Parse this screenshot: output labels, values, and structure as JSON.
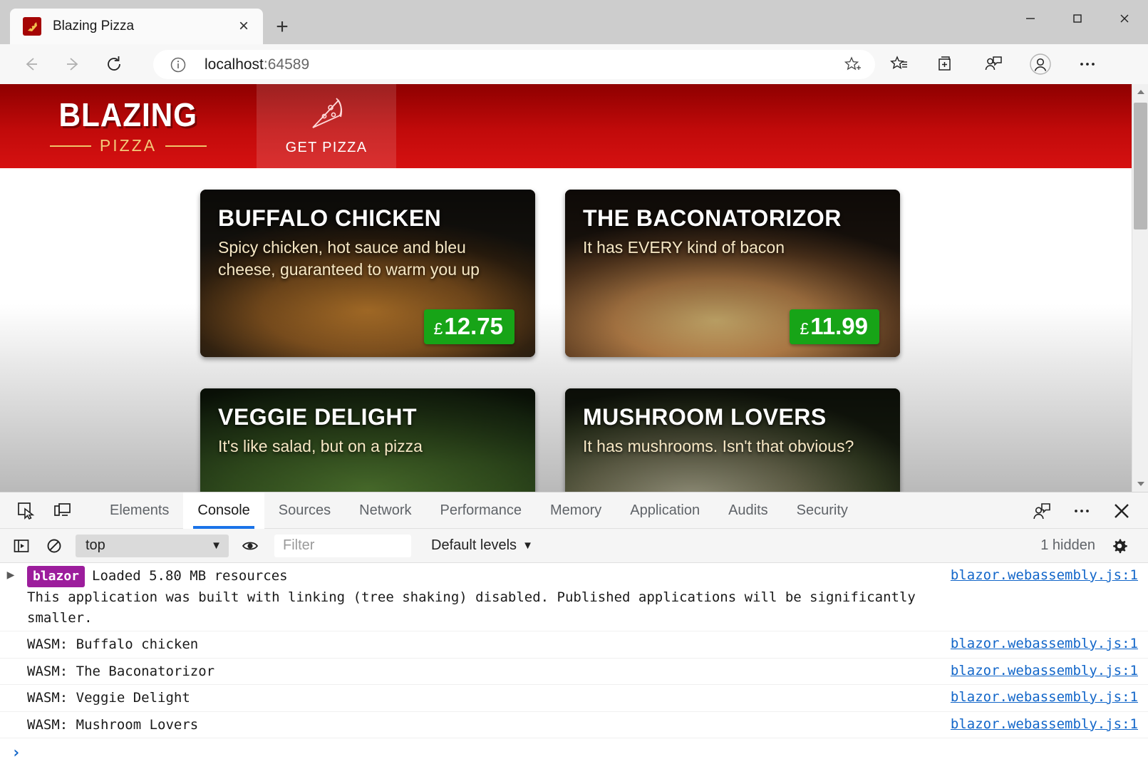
{
  "window": {
    "controls": [
      {
        "name": "minimize-button",
        "glyph": "minimize"
      },
      {
        "name": "maximize-button",
        "glyph": "maximize"
      },
      {
        "name": "close-button",
        "glyph": "close"
      }
    ]
  },
  "browser": {
    "tab": {
      "title": "Blazing Pizza",
      "close_label": "×",
      "favicon": "pizza-slice-icon"
    },
    "new_tab_label": "+",
    "back_icon": "back-arrow-icon",
    "forward_icon": "forward-arrow-icon",
    "reload_icon": "reload-icon",
    "omnibox": {
      "info_icon": "site-info-icon",
      "host": "localhost",
      "port": ":64589",
      "favorite_icon": "add-favorite-icon"
    },
    "toolbar_icons": [
      "favorites-icon",
      "collections-icon",
      "feedback-icon",
      "profile-icon",
      "settings-more-icon"
    ]
  },
  "site": {
    "logo": {
      "top": "BLAZING",
      "bottom": "PIZZA"
    },
    "nav": {
      "get_pizza_label": "GET PIZZA",
      "icon": "pizza-slice-icon"
    },
    "brand_red": "#c10a0a",
    "brand_gold": "#f3c97a",
    "price_green": "#17a417",
    "pizzas": [
      {
        "title": "BUFFALO CHICKEN",
        "description": "Spicy chicken, hot sauce and bleu cheese, guaranteed to warm you up",
        "price": "12.75",
        "currency": "£"
      },
      {
        "title": "THE BACONATORIZOR",
        "description": "It has EVERY kind of bacon",
        "price": "11.99",
        "currency": "£"
      },
      {
        "title": "VEGGIE DELIGHT",
        "description": "It's like salad, but on a pizza",
        "price": "",
        "currency": "£"
      },
      {
        "title": "MUSHROOM LOVERS",
        "description": "It has mushrooms. Isn't that obvious?",
        "price": "",
        "currency": "£"
      }
    ]
  },
  "devtools": {
    "inspect_icon": "inspect-element-icon",
    "device_icon": "device-emulation-icon",
    "tabs": [
      {
        "label": "Elements",
        "active": false
      },
      {
        "label": "Console",
        "active": true
      },
      {
        "label": "Sources",
        "active": false
      },
      {
        "label": "Network",
        "active": false
      },
      {
        "label": "Performance",
        "active": false
      },
      {
        "label": "Memory",
        "active": false
      },
      {
        "label": "Application",
        "active": false
      },
      {
        "label": "Audits",
        "active": false
      },
      {
        "label": "Security",
        "active": false
      }
    ],
    "right_icons": [
      "feedback-icon",
      "more-tools-icon",
      "close-devtools-icon"
    ],
    "filterbar": {
      "sidebar_icon": "console-sidebar-icon",
      "clear_icon": "clear-console-icon",
      "context": "top",
      "context_caret": "▼",
      "eye_icon": "live-expression-icon",
      "filter_placeholder": "Filter",
      "filter_value": "",
      "levels_label": "Default levels",
      "levels_caret": "▼",
      "hidden_count": "1 hidden",
      "settings_icon": "console-settings-icon"
    },
    "console": {
      "messages": [
        {
          "disclosure": "▶",
          "badge": "blazor",
          "text": "Loaded 5.80 MB resources",
          "detail": "This application was built with linking (tree shaking) disabled. Published applications will be significantly smaller.",
          "source": "blazor.webassembly.js:1"
        },
        {
          "disclosure": "",
          "badge": "",
          "text": "WASM: Buffalo chicken",
          "detail": "",
          "source": "blazor.webassembly.js:1"
        },
        {
          "disclosure": "",
          "badge": "",
          "text": "WASM: The Baconatorizor",
          "detail": "",
          "source": "blazor.webassembly.js:1"
        },
        {
          "disclosure": "",
          "badge": "",
          "text": "WASM: Veggie Delight",
          "detail": "",
          "source": "blazor.webassembly.js:1"
        },
        {
          "disclosure": "",
          "badge": "",
          "text": "WASM: Mushroom Lovers",
          "detail": "",
          "source": "blazor.webassembly.js:1"
        }
      ],
      "prompt_chevron": "›",
      "prompt_value": ""
    }
  }
}
